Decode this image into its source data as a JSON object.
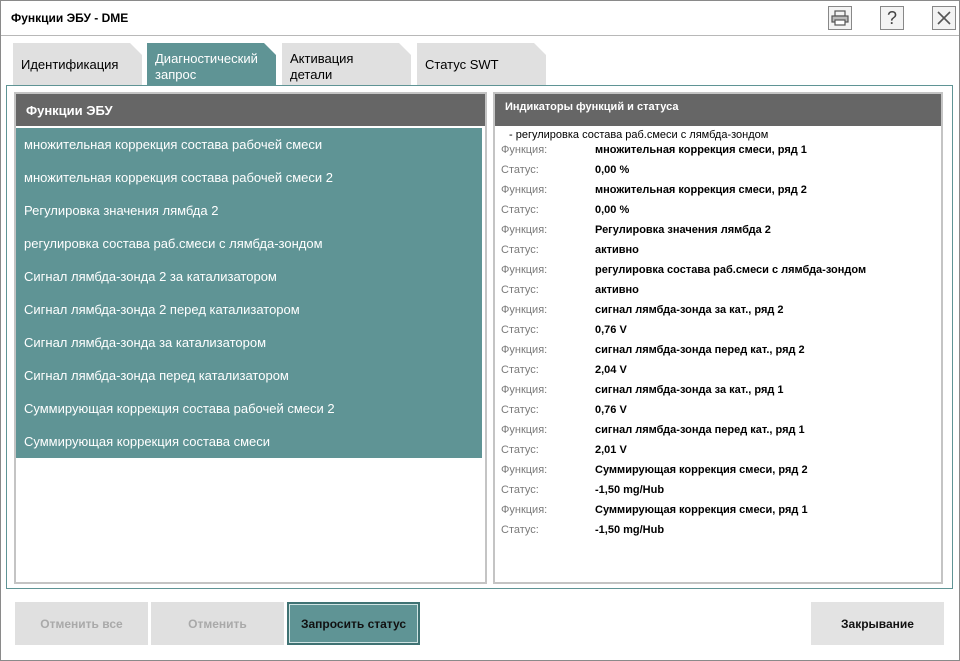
{
  "window": {
    "title": "Функции ЭБУ - DME"
  },
  "tabs": [
    {
      "line1": "Идентификация",
      "line2": ""
    },
    {
      "line1": "Диагностический",
      "line2": "запрос"
    },
    {
      "line1": "Активация",
      "line2": "детали"
    },
    {
      "line1": "Статус SWT",
      "line2": ""
    }
  ],
  "active_tab_index": 1,
  "left_panel": {
    "header": "Функции ЭБУ",
    "items": [
      "множительная коррекция состава рабочей смеси",
      "множительная коррекция состава рабочей смеси 2",
      "Регулировка значения лямбда 2",
      "регулировка состава раб.смеси с лямбда-зондом",
      "Сигнал лямбда-зонда 2 за катализатором",
      "Сигнал лямбда-зонда 2 перед катализатором",
      "Сигнал лямбда-зонда за катализатором",
      "Сигнал лямбда-зонда перед катализатором",
      "Суммирующая коррекция состава рабочей смеси 2",
      "Суммирующая коррекция состава смеси"
    ]
  },
  "right_panel": {
    "header": "Индикаторы функций и статуса",
    "subtitle": "- регулировка состава раб.смеси с лямбда-зондом",
    "rows": [
      {
        "label": "Функция:",
        "value": "множительная коррекция смеси, ряд 1"
      },
      {
        "label": "Статус:",
        "value": "0,00  %"
      },
      {
        "label": "Функция:",
        "value": "множительная коррекция смеси, ряд 2"
      },
      {
        "label": "Статус:",
        "value": "0,00  %"
      },
      {
        "label": "Функция:",
        "value": "Регулировка значения лямбда 2"
      },
      {
        "label": "Статус:",
        "value": "активно"
      },
      {
        "label": "Функция:",
        "value": "регулировка состава раб.смеси с лямбда-зондом"
      },
      {
        "label": "Статус:",
        "value": "активно"
      },
      {
        "label": "Функция:",
        "value": "сигнал лямбда-зонда за кат., ряд 2"
      },
      {
        "label": "Статус:",
        "value": "0,76  V"
      },
      {
        "label": "Функция:",
        "value": "сигнал лямбда-зонда перед кат., ряд 2"
      },
      {
        "label": "Статус:",
        "value": "2,04  V"
      },
      {
        "label": "Функция:",
        "value": "сигнал лямбда-зонда за кат., ряд 1"
      },
      {
        "label": "Статус:",
        "value": "0,76  V"
      },
      {
        "label": "Функция:",
        "value": "сигнал лямбда-зонда перед кат., ряд 1"
      },
      {
        "label": "Статус:",
        "value": "2,01  V"
      },
      {
        "label": "Функция:",
        "value": "Суммирующая коррекция смеси, ряд 2"
      },
      {
        "label": "Статус:",
        "value": "-1,50 mg/Hub"
      },
      {
        "label": "Функция:",
        "value": "Суммирующая коррекция смеси, ряд 1"
      },
      {
        "label": "Статус:",
        "value": "-1,50 mg/Hub"
      }
    ]
  },
  "buttons": {
    "cancel_all": "Отменить все",
    "cancel": "Отменить",
    "request_status": "Запросить статус",
    "close": "Закрывание"
  },
  "toolbar_icons": [
    "printer-icon",
    "help-icon",
    "close-icon"
  ],
  "help_glyph": "?",
  "colors": {
    "accent": "#5f9495",
    "header_gray": "#666666",
    "tab_inactive": "#e0e0e0"
  }
}
